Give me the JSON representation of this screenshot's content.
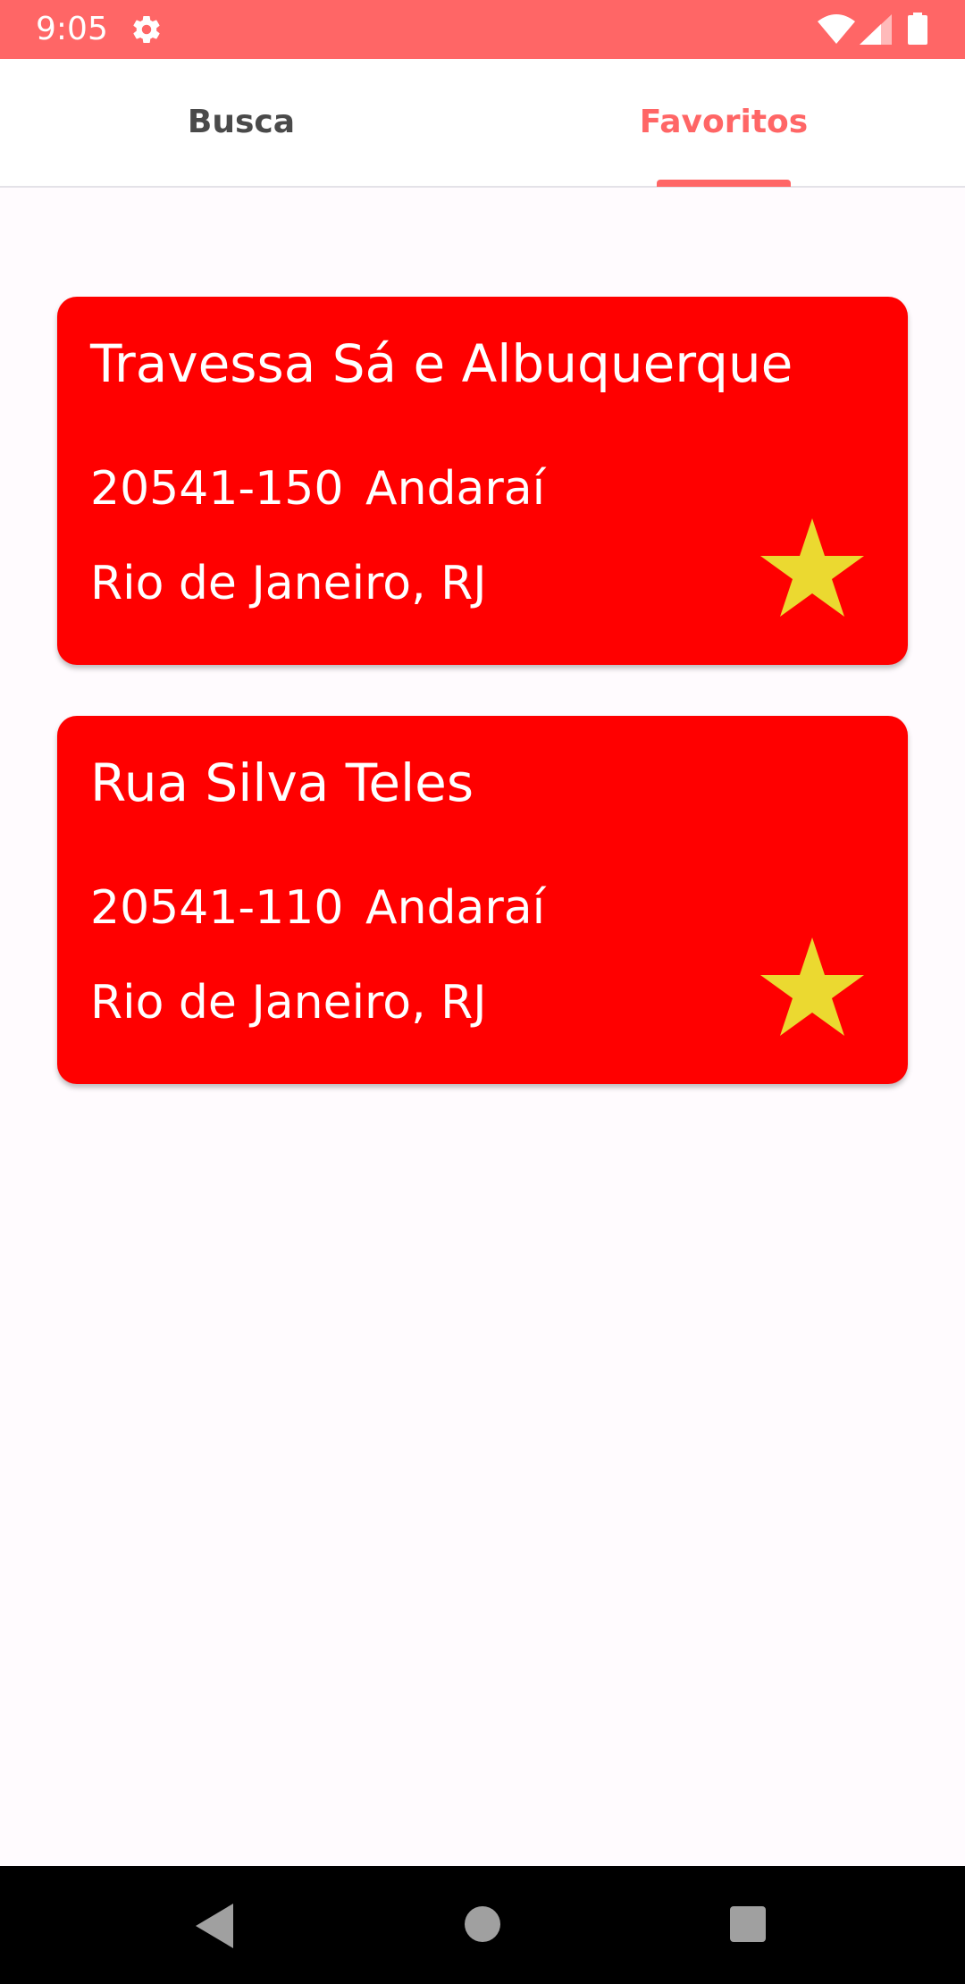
{
  "status_bar": {
    "time": "9:05",
    "icons": [
      "gear-icon",
      "wifi-icon",
      "signal-icon",
      "battery-icon"
    ],
    "background": "#ff6666"
  },
  "tabs": [
    {
      "label": "Busca",
      "selected": false
    },
    {
      "label": "Favoritos",
      "selected": true
    }
  ],
  "favorites": [
    {
      "street": "Travessa Sá e Albuquerque",
      "cep": "20541-150",
      "neighborhood": "Andaraí",
      "city": "Rio de Janeiro, RJ",
      "favorite_icon": "star-icon"
    },
    {
      "street": "Rua Silva Teles",
      "cep": "20541-110",
      "neighborhood": "Andaraí",
      "city": "Rio de Janeiro, RJ",
      "favorite_icon": "star-icon"
    }
  ],
  "colors": {
    "accent": "#ff6666",
    "card_background": "#ff0000",
    "star": "#ebd930",
    "page_background": "#fffbfe"
  },
  "nav_bar": {
    "icons": [
      "back-icon",
      "home-icon",
      "recents-icon"
    ]
  }
}
